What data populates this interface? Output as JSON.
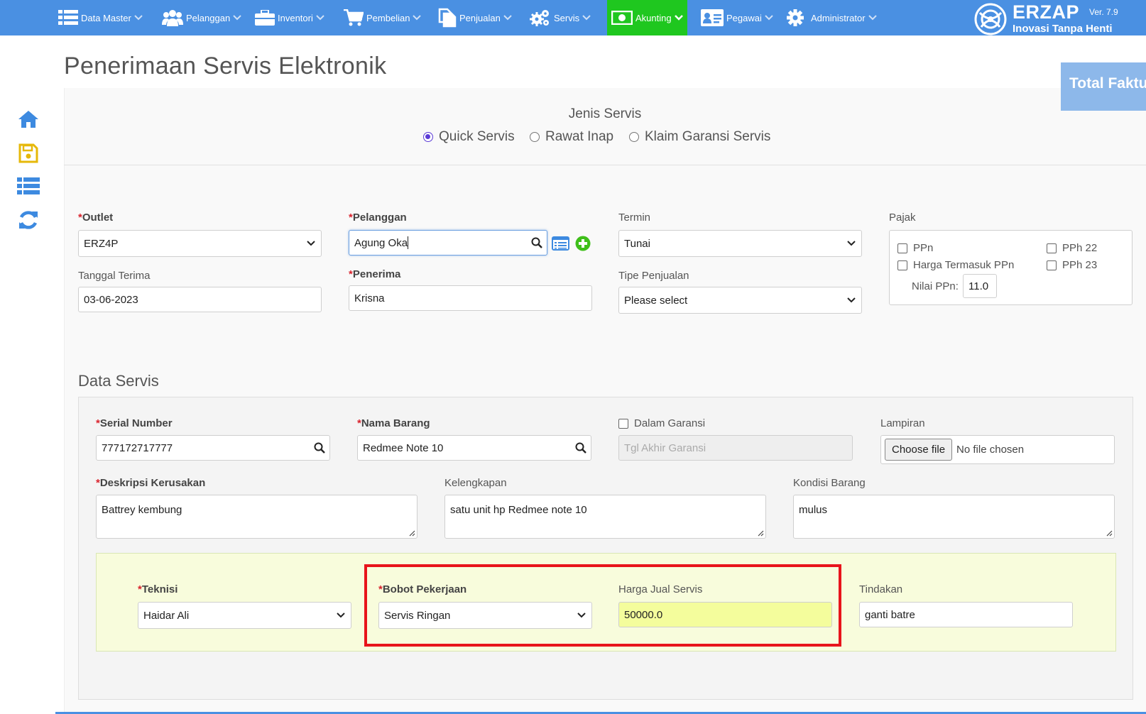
{
  "nav": {
    "items": [
      {
        "label": "Data Master",
        "icon": "list-icon"
      },
      {
        "label": "Pelanggan",
        "icon": "users-icon"
      },
      {
        "label": "Inventori",
        "icon": "briefcase-icon"
      },
      {
        "label": "Pembelian",
        "icon": "cart-icon"
      },
      {
        "label": "Penjualan",
        "icon": "files-icon"
      },
      {
        "label": "Servis",
        "icon": "gears-icon"
      },
      {
        "label": "Akunting",
        "icon": "money-icon",
        "active": true
      },
      {
        "label": "Pegawai",
        "icon": "id-card-icon"
      },
      {
        "label": "Administrator",
        "icon": "gear-icon"
      }
    ],
    "brand": {
      "name": "ERZAP",
      "version": "Ver. 7.9",
      "tagline": "Inovasi Tanpa Henti"
    },
    "active_color": "#1fc71f",
    "bar_color": "#4a90e2"
  },
  "sidebar": {
    "icons": [
      "home-icon",
      "save-icon",
      "list-view-icon",
      "refresh-icon"
    ]
  },
  "page": {
    "title": "Penerimaan Servis Elektronik",
    "total_faktur": "Total Faktu"
  },
  "jenis_servis": {
    "title": "Jenis Servis",
    "options": [
      "Quick Servis",
      "Rawat Inap",
      "Klaim Garansi Servis"
    ],
    "selected": "Quick Servis"
  },
  "form": {
    "outlet": {
      "label": "Outlet",
      "value": "ERZ4P"
    },
    "pelanggan": {
      "label": "Pelanggan",
      "value": "Agung Oka"
    },
    "termin": {
      "label": "Termin",
      "value": "Tunai"
    },
    "pajak": {
      "label": "Pajak",
      "ppn": "PPn",
      "harga_termasuk_ppn": "Harga Termasuk PPn",
      "pph22": "PPh 22",
      "pph23": "PPh 23",
      "nilai_ppn_label": "Nilai PPn:",
      "nilai_ppn": "11.0"
    },
    "tanggal_terima": {
      "label": "Tanggal Terima",
      "value": "03-06-2023"
    },
    "penerima": {
      "label": "Penerima",
      "value": "Krisna"
    },
    "tipe_penjualan": {
      "label": "Tipe Penjualan",
      "value": "Please select"
    }
  },
  "data_servis": {
    "title": "Data Servis",
    "serial_number": {
      "label": "Serial Number",
      "value": "777172717777"
    },
    "nama_barang": {
      "label": "Nama Barang",
      "value": "Redmee Note 10"
    },
    "dalam_garansi": {
      "label": "Dalam Garansi",
      "placeholder": "Tgl Akhir Garansi"
    },
    "lampiran": {
      "label": "Lampiran",
      "button": "Choose file",
      "status": "No file chosen"
    },
    "deskripsi": {
      "label": "Deskripsi Kerusakan",
      "value": "Battrey kembung"
    },
    "kelengkapan": {
      "label": "Kelengkapan",
      "value": "satu unit hp Redmee note 10"
    },
    "kondisi": {
      "label": "Kondisi Barang",
      "value": "mulus"
    },
    "teknisi": {
      "label": "Teknisi",
      "value": "Haidar Ali"
    },
    "bobot": {
      "label": "Bobot Pekerjaan",
      "value": "Servis Ringan"
    },
    "harga_jual": {
      "label": "Harga Jual Servis",
      "value": "50000.0"
    },
    "tindakan": {
      "label": "Tindakan",
      "value": "ganti batre"
    }
  }
}
